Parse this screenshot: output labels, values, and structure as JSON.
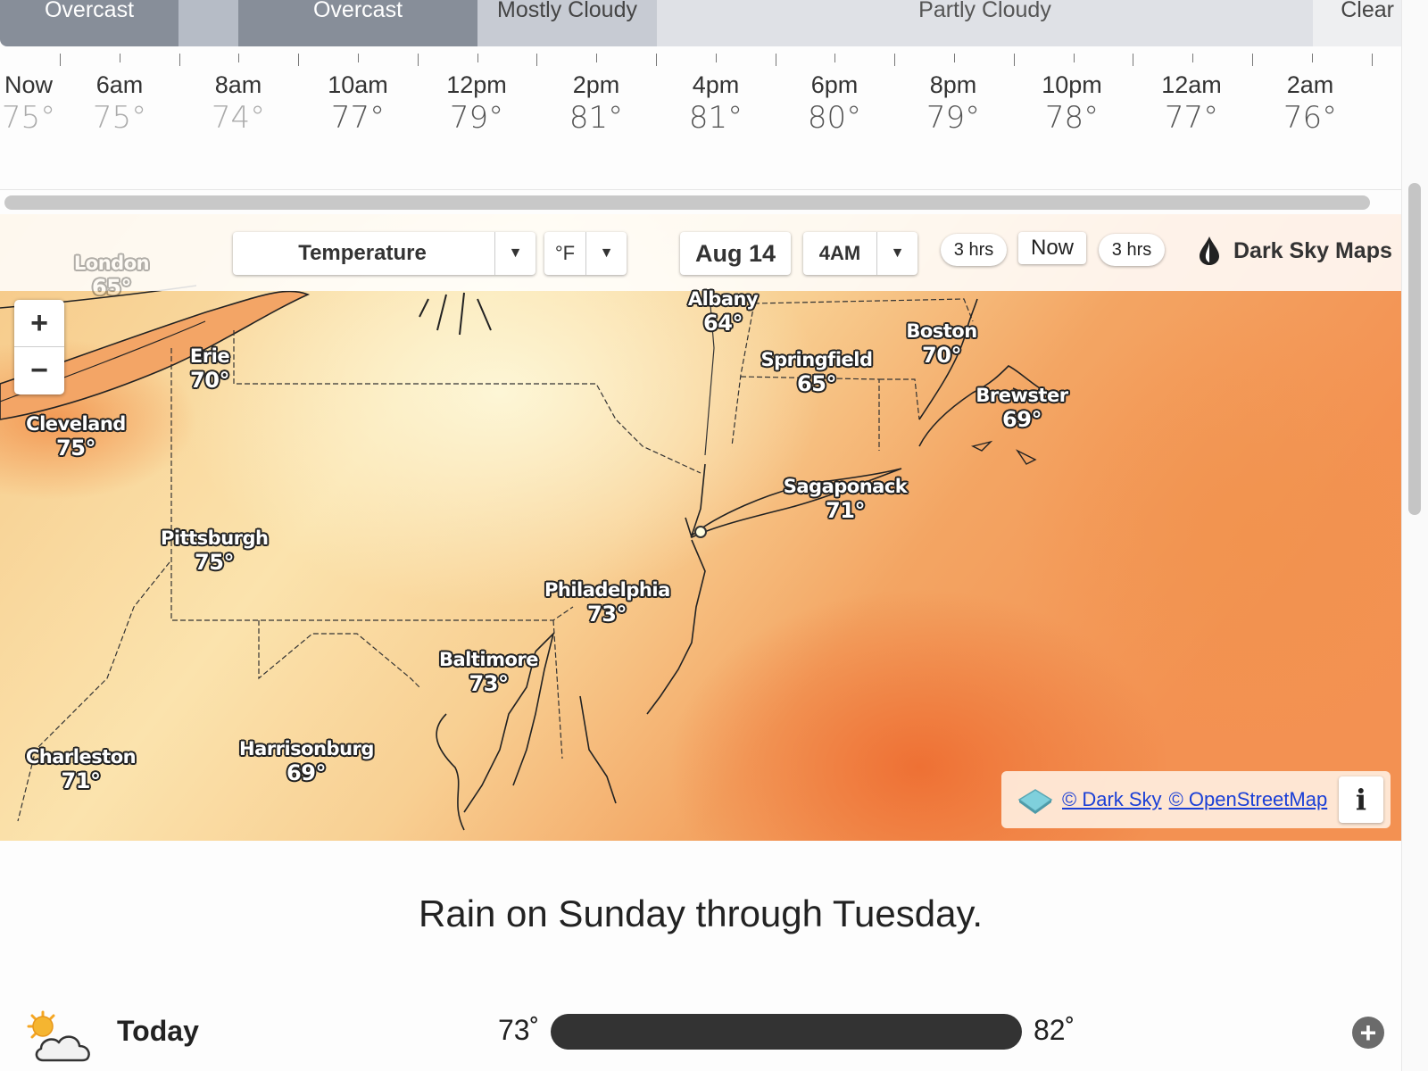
{
  "conditions": [
    {
      "label": "Overcast",
      "kind": "overcast"
    },
    {
      "label": "",
      "kind": "gap"
    },
    {
      "label": "Overcast",
      "kind": "overcast"
    },
    {
      "label": "Mostly Cloudy",
      "kind": "mostly"
    },
    {
      "label": "Partly Cloudy",
      "kind": "partly"
    },
    {
      "label": "Clear",
      "kind": "clear"
    }
  ],
  "hourly": [
    {
      "time": "Now",
      "temp": "75°"
    },
    {
      "time": "6am",
      "temp": "75°"
    },
    {
      "time": "8am",
      "temp": "74°"
    },
    {
      "time": "10am",
      "temp": "77°"
    },
    {
      "time": "12pm",
      "temp": "79°"
    },
    {
      "time": "2pm",
      "temp": "81°"
    },
    {
      "time": "4pm",
      "temp": "81°"
    },
    {
      "time": "6pm",
      "temp": "80°"
    },
    {
      "time": "8pm",
      "temp": "79°"
    },
    {
      "time": "10pm",
      "temp": "78°"
    },
    {
      "time": "12am",
      "temp": "77°"
    },
    {
      "time": "2am",
      "temp": "76°"
    }
  ],
  "map": {
    "layer": "Temperature",
    "unit": "°F",
    "date": "Aug 14",
    "time": "4AM",
    "step_back": "3 hrs",
    "now": "Now",
    "step_forward": "3 hrs",
    "brand": "Dark Sky Maps",
    "zoom_in": "+",
    "zoom_out": "−",
    "attribution_darksky": "© Dark Sky",
    "attribution_osm": "© OpenStreetMap",
    "info": "i",
    "cities": [
      {
        "name": "London",
        "temp": "65°",
        "faded": true
      },
      {
        "name": "Albany",
        "temp": "64°"
      },
      {
        "name": "Boston",
        "temp": "70°"
      },
      {
        "name": "Erie",
        "temp": "70°"
      },
      {
        "name": "Springfield",
        "temp": "65°"
      },
      {
        "name": "Brewster",
        "temp": "69°"
      },
      {
        "name": "Cleveland",
        "temp": "75°"
      },
      {
        "name": "Sagaponack",
        "temp": "71°"
      },
      {
        "name": "Pittsburgh",
        "temp": "75°"
      },
      {
        "name": "Philadelphia",
        "temp": "73°"
      },
      {
        "name": "Baltimore",
        "temp": "73°"
      },
      {
        "name": "Charleston",
        "temp": "71°"
      },
      {
        "name": "Harrisonburg",
        "temp": "69°"
      }
    ]
  },
  "summary": "Rain on Sunday through Tuesday.",
  "daily": [
    {
      "day": "Today",
      "low": "73˚",
      "high": "82˚",
      "icon": "partly-cloudy-day-icon",
      "expand": "+"
    }
  ],
  "colors": {
    "overcast": "#878e99",
    "mostly_cloudy": "#c7cbd3",
    "partly_cloudy": "#dfe1e6",
    "clear": "#eeeff1",
    "temp_warm": "#f08a45",
    "temp_mild": "#fbe6b4",
    "link": "#1a3fd6"
  }
}
